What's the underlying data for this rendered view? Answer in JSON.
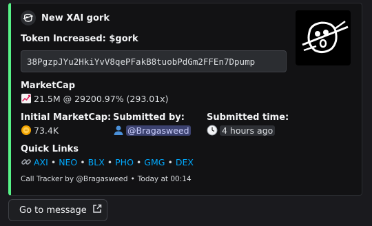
{
  "embed": {
    "accent_color": "#57f287",
    "author": {
      "icon": "gork-face-icon",
      "name": "New XAI gork"
    },
    "thumbnail": "gork-face-image",
    "title": "Token Increased: $gork",
    "contract_address": "38PgzpJYu2HkiYvV8qePFakB8tuobPdGm2FFEn7Dpump",
    "market_cap": {
      "label": "MarketCap",
      "icon": "chart-increasing-icon",
      "value": "21.5M @ 29200.97% (293.01x)"
    },
    "initial_market_cap": {
      "label": "Initial MarketCap:",
      "icon": "coin-icon",
      "value": "73.4K"
    },
    "submitted_by": {
      "label": "Submitted by:",
      "icon": "user-silhouette-icon",
      "value": "@Bragasweed"
    },
    "submitted_time": {
      "label": "Submitted time:",
      "icon": "clock-icon",
      "value": "4 hours ago"
    },
    "quick_links": {
      "label": "Quick Links",
      "icon": "link-icon",
      "items": [
        "AXI",
        "NEO",
        "BLX",
        "PHO",
        "GMG",
        "DEX"
      ],
      "separator": "•"
    },
    "footer": {
      "text": "Call Tracker by @Bragasweed",
      "separator": "•",
      "timestamp": "Today at 00:14"
    }
  },
  "goto_button": {
    "label": "Go to message",
    "icon": "external-link-icon"
  }
}
